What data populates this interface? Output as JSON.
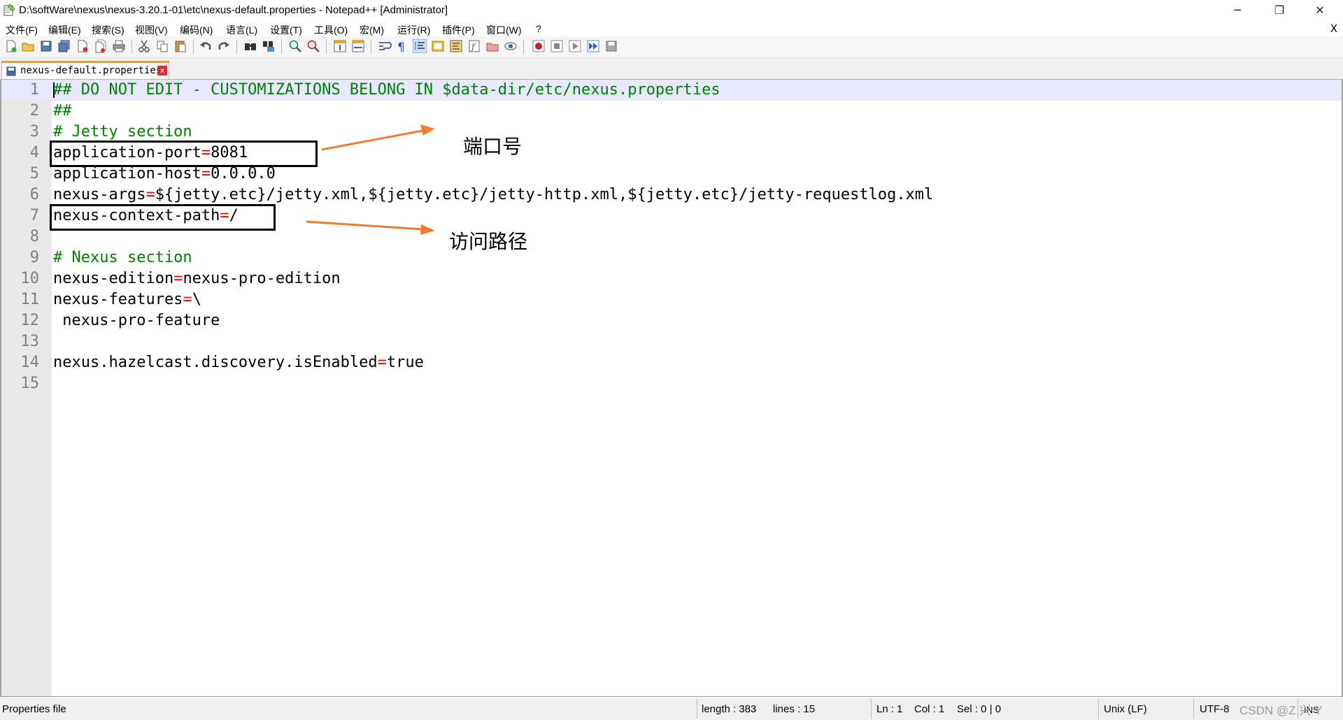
{
  "window": {
    "title": "D:\\softWare\\nexus\\nexus-3.20.1-01\\etc\\nexus-default.properties - Notepad++ [Administrator]",
    "minimize": "─",
    "restore": "❐",
    "close": "✕"
  },
  "menu": {
    "items": [
      "文件(F)",
      "编辑(E)",
      "搜索(S)",
      "视图(V)",
      "编码(N)",
      "语言(L)",
      "设置(T)",
      "工具(O)",
      "宏(M)",
      "运行(R)",
      "插件(P)",
      "窗口(W)",
      "?"
    ],
    "close": "X"
  },
  "toolbar": {
    "icons": [
      "new-file-icon",
      "open-file-icon",
      "save-icon",
      "save-all-icon",
      "close-icon",
      "close-all-icon",
      "print-icon",
      "cut-icon",
      "copy-icon",
      "paste-icon",
      "undo-icon",
      "redo-icon",
      "find-icon",
      "replace-icon",
      "zoom-in-icon",
      "zoom-out-icon",
      "sync-vertical-icon",
      "sync-horizontal-icon",
      "word-wrap-icon",
      "show-all-chars-icon",
      "indent-guide-icon",
      "language-icon",
      "document-map-icon",
      "function-list-icon",
      "folder-workspace-icon",
      "monitoring-icon",
      "record-macro-icon",
      "stop-record-icon",
      "play-macro-icon",
      "run-multiple-icon",
      "save-macro-icon"
    ]
  },
  "tab": {
    "label": "nexus-default.properties",
    "close": "x"
  },
  "editor": {
    "lines": [
      {
        "n": "1",
        "parts": [
          {
            "t": "## DO NOT EDIT - CUSTOMIZATIONS BELONG IN $data-dir/etc/nexus.properties",
            "c": "comment"
          }
        ]
      },
      {
        "n": "2",
        "parts": [
          {
            "t": "##",
            "c": "comment"
          }
        ]
      },
      {
        "n": "3",
        "parts": [
          {
            "t": "# Jetty section",
            "c": "comment"
          }
        ]
      },
      {
        "n": "4",
        "parts": [
          {
            "t": "application-port",
            "c": "key"
          },
          {
            "t": "=",
            "c": "op"
          },
          {
            "t": "8081",
            "c": "val"
          }
        ]
      },
      {
        "n": "5",
        "parts": [
          {
            "t": "application-host",
            "c": "key"
          },
          {
            "t": "=",
            "c": "op"
          },
          {
            "t": "0.0.0.0",
            "c": "val"
          }
        ]
      },
      {
        "n": "6",
        "parts": [
          {
            "t": "nexus-args",
            "c": "key"
          },
          {
            "t": "=",
            "c": "op"
          },
          {
            "t": "${jetty.etc}/jetty.xml,${jetty.etc}/jetty-http.xml,${jetty.etc}/jetty-requestlog.xml",
            "c": "val"
          }
        ]
      },
      {
        "n": "7",
        "parts": [
          {
            "t": "nexus-context-path",
            "c": "key"
          },
          {
            "t": "=",
            "c": "op"
          },
          {
            "t": "/",
            "c": "val"
          }
        ]
      },
      {
        "n": "8",
        "parts": []
      },
      {
        "n": "9",
        "parts": [
          {
            "t": "# Nexus section",
            "c": "comment"
          }
        ]
      },
      {
        "n": "10",
        "parts": [
          {
            "t": "nexus-edition",
            "c": "key"
          },
          {
            "t": "=",
            "c": "op"
          },
          {
            "t": "nexus-pro-edition",
            "c": "val"
          }
        ]
      },
      {
        "n": "11",
        "parts": [
          {
            "t": "nexus-features",
            "c": "key"
          },
          {
            "t": "=",
            "c": "op"
          },
          {
            "t": "\\",
            "c": "val"
          }
        ]
      },
      {
        "n": "12",
        "parts": [
          {
            "t": " nexus-pro-feature",
            "c": "val"
          }
        ]
      },
      {
        "n": "13",
        "parts": []
      },
      {
        "n": "14",
        "parts": [
          {
            "t": "nexus.hazelcast.discovery.isEnabled",
            "c": "key"
          },
          {
            "t": "=",
            "c": "op"
          },
          {
            "t": "true",
            "c": "val"
          }
        ]
      },
      {
        "n": "15",
        "parts": []
      }
    ]
  },
  "annotations": {
    "port": "端口号",
    "path": "访问路径",
    "arrow_color": "#ed7d31"
  },
  "status": {
    "file_type": "Properties file",
    "length": "length : 383",
    "lines": "lines : 15",
    "ln": "Ln : 1",
    "col": "Col : 1",
    "sel": "Sel : 0 | 0",
    "eol": "Unix (LF)",
    "encoding": "UTF-8",
    "mode": "INS",
    "watermark": "CSDN @Z 兴 Y"
  },
  "colors": {
    "comment": "#008000",
    "operator": "#ff0000",
    "current_line": "#e8e8ff",
    "gutter": "#e8e8e8",
    "tab_accent": "#f0a020"
  }
}
